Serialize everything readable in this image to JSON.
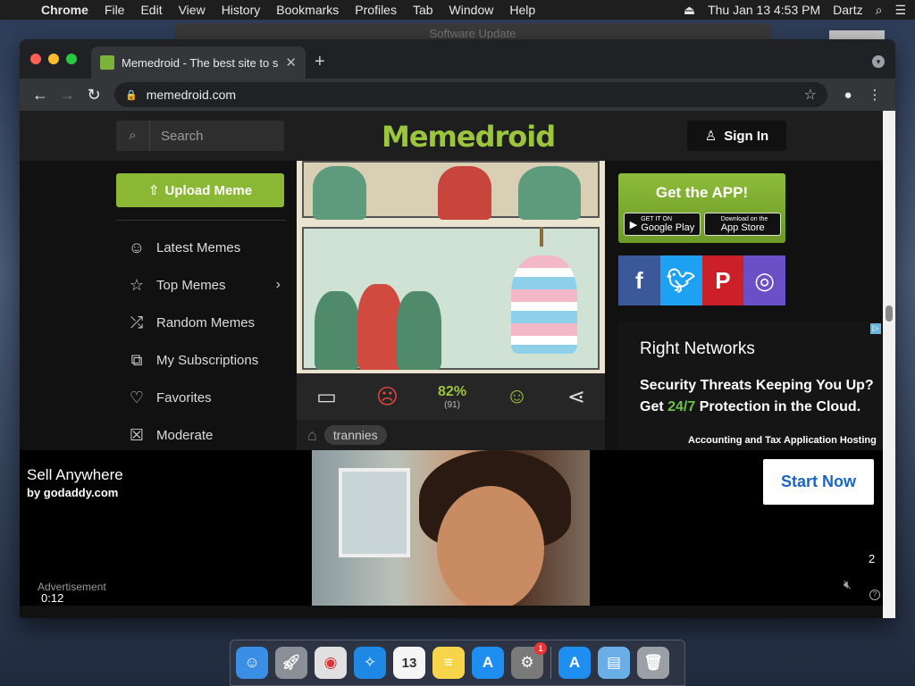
{
  "menubar": {
    "app": "Chrome",
    "items": [
      "File",
      "Edit",
      "View",
      "History",
      "Bookmarks",
      "Profiles",
      "Tab",
      "Window",
      "Help"
    ],
    "datetime": "Thu Jan 13  4:53 PM",
    "user": "Dartz"
  },
  "background_window": {
    "title": "Software Update",
    "search_placeholder": "Search"
  },
  "browser": {
    "tab_title": "Memedroid - The best site to s",
    "url": "memedroid.com"
  },
  "site": {
    "search_placeholder": "Search",
    "logo": "Memedroid",
    "sign_in": "Sign In",
    "upload": "Upload Meme",
    "nav": [
      {
        "label": "Latest Memes",
        "icon": "latest-icon"
      },
      {
        "label": "Top Memes",
        "icon": "star-icon"
      },
      {
        "label": "Random Memes",
        "icon": "shuffle-icon"
      },
      {
        "label": "My Subscriptions",
        "icon": "subscriptions-icon"
      },
      {
        "label": "Favorites",
        "icon": "heart-icon"
      },
      {
        "label": "Moderate",
        "icon": "moderate-icon"
      }
    ],
    "score": {
      "percent": "82%",
      "votes": "(91)"
    },
    "tag": "trannies",
    "app_box": {
      "title": "Get the APP!",
      "google": "Google Play",
      "apple": "App Store",
      "google_small": "GET IT ON",
      "apple_small": "Download on the"
    },
    "social": [
      "facebook-icon",
      "twitter-icon",
      "pinterest-icon",
      "instagram-icon"
    ],
    "social_colors": [
      "#3b5998",
      "#1da1f2",
      "#cb2027",
      "#6a4fc7"
    ]
  },
  "ad_right": {
    "brand": "Right Networks",
    "headline_1": "Security Threats Keeping You Up?",
    "headline_2_pre": "Get ",
    "headline_2_hl": "24/7",
    "headline_2_post": " Protection in the Cloud.",
    "footer": "Accounting and Tax Application Hosting"
  },
  "video_ad": {
    "title": "Sell Anywhere",
    "by": "by godaddy.com",
    "label": "Advertisement",
    "time": "0:12",
    "cta": "Start Now",
    "count": "2"
  },
  "dock": [
    {
      "name": "finder-icon",
      "color": "#3a8ee6"
    },
    {
      "name": "launchpad-icon",
      "color": "#8a8f98"
    },
    {
      "name": "chrome-icon",
      "color": "#e0e0e0"
    },
    {
      "name": "safari-icon",
      "color": "#1e88e5"
    },
    {
      "name": "calendar-icon",
      "color": "#f5f5f5",
      "text": "13"
    },
    {
      "name": "notes-icon",
      "color": "#f7d54a"
    },
    {
      "name": "app-store-icon",
      "color": "#1f8ef1"
    },
    {
      "name": "system-preferences-icon",
      "color": "#7a7a7a",
      "badge": "1"
    }
  ],
  "dock_right": [
    {
      "name": "app-store-download-icon",
      "color": "#1f8ef1"
    },
    {
      "name": "downloads-folder-icon",
      "color": "#6aaee8"
    },
    {
      "name": "trash-icon",
      "color": "#9aa0a6"
    }
  ]
}
